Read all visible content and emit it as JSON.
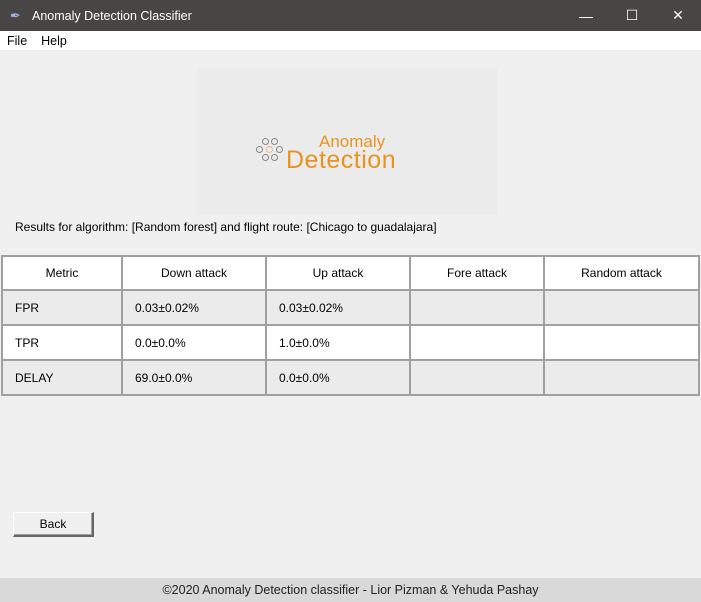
{
  "window": {
    "title": "Anomaly Detection Classifier",
    "minimize": "—",
    "maximize": "☐",
    "close": "✕"
  },
  "menu": [
    "File",
    "Help"
  ],
  "logo": {
    "line1": "Anomaly",
    "line2": "Detection"
  },
  "results_text": "Results for algorithm: [Random forest] and flight route: [Chicago to guadalajara]",
  "table": {
    "headers": [
      "Metric",
      "Down attack",
      "Up attack",
      "Fore attack",
      "Random attack"
    ],
    "rows": [
      [
        "FPR",
        "0.03±0.02%",
        "0.03±0.02%",
        "",
        ""
      ],
      [
        "TPR",
        "0.0±0.0%",
        "1.0±0.0%",
        "",
        ""
      ],
      [
        "DELAY",
        "69.0±0.0%",
        "0.0±0.0%",
        "",
        ""
      ]
    ]
  },
  "back_label": "Back",
  "footer": "©2020 Anomaly Detection classifier - Lior Pizman & Yehuda Pashay",
  "colors": {
    "accent": "#e8931f",
    "titlebar": "#474644"
  }
}
